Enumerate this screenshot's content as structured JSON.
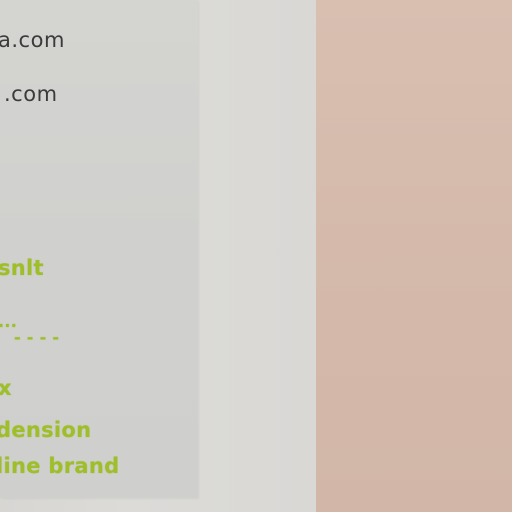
{
  "whiteboard": {
    "email_lines": [
      "a.com",
      ".com"
    ],
    "notes": [
      "snlt",
      "...",
      "- - - -",
      "x",
      "dension",
      "line brand"
    ]
  },
  "colors": {
    "ink_dark": "#3b3b3b",
    "ink_green": "#9fbf2a",
    "wall": "#d4b9aa",
    "board": "#dad9d6"
  }
}
